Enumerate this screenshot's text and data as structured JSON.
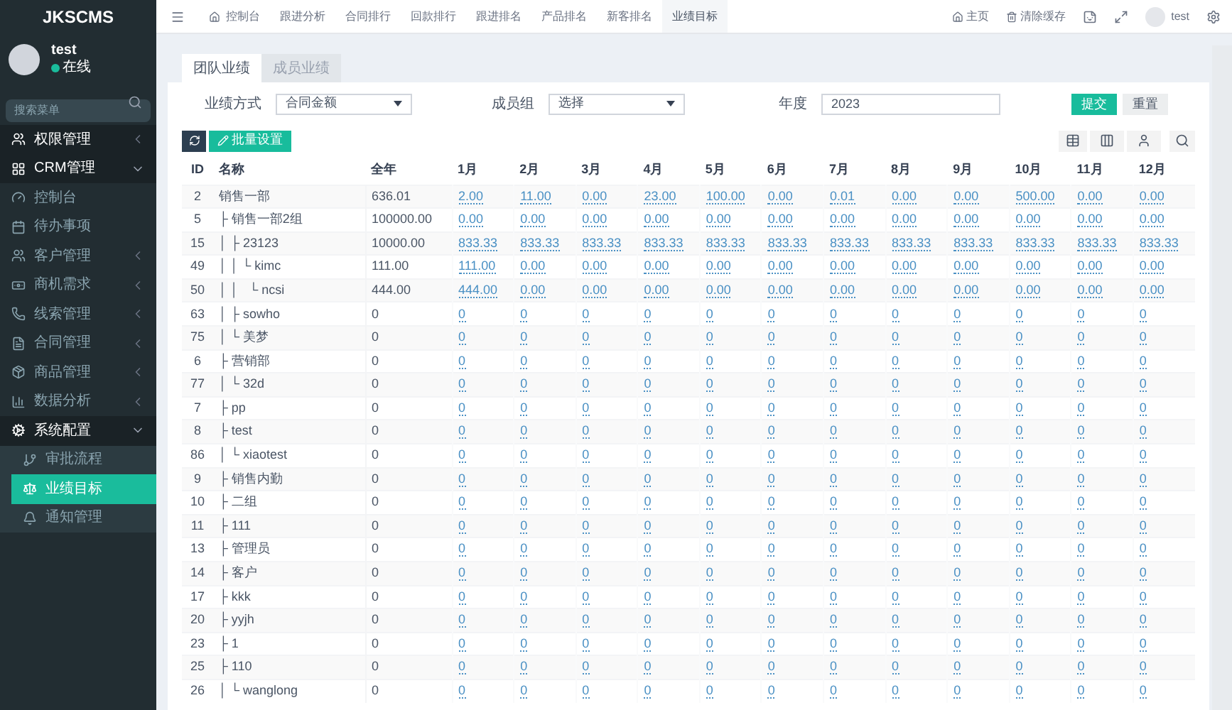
{
  "brand": "JKSCMS",
  "user": {
    "name": "test",
    "status": "在线"
  },
  "sidebar": {
    "search_placeholder": "搜索菜单",
    "items": [
      {
        "label": "权限管理",
        "expanded": false,
        "selected": false
      },
      {
        "label": "CRM管理",
        "expanded": true,
        "selected": false,
        "children": [
          {
            "label": "控制台",
            "selected": false
          },
          {
            "label": "待办事项",
            "selected": false
          },
          {
            "label": "客户管理",
            "selected": false,
            "expanded": false
          },
          {
            "label": "商机需求",
            "selected": false,
            "expanded": false
          },
          {
            "label": "线索管理",
            "selected": false,
            "expanded": false
          },
          {
            "label": "合同管理",
            "selected": false,
            "expanded": false
          },
          {
            "label": "商品管理",
            "selected": false,
            "expanded": false
          },
          {
            "label": "数据分析",
            "selected": false,
            "expanded": false
          },
          {
            "label": "系统配置",
            "selected": false,
            "expanded": true,
            "children": [
              {
                "label": "审批流程",
                "selected": false
              },
              {
                "label": "业绩目标",
                "selected": true
              },
              {
                "label": "通知管理",
                "selected": false
              }
            ]
          }
        ]
      }
    ]
  },
  "nav_tabs": [
    {
      "label": "控制台",
      "selected": false
    },
    {
      "label": "跟进分析",
      "selected": false
    },
    {
      "label": "合同排行",
      "selected": false
    },
    {
      "label": "回款排行",
      "selected": false
    },
    {
      "label": "跟进排名",
      "selected": false
    },
    {
      "label": "产品排名",
      "selected": false
    },
    {
      "label": "新客排名",
      "selected": false
    },
    {
      "label": "业绩目标",
      "selected": true
    }
  ],
  "top_right": {
    "home": "主页",
    "clear_cache": "清除缓存",
    "user": "test"
  },
  "tabs": [
    {
      "label": "团队业绩",
      "selected": true
    },
    {
      "label": "成员业绩",
      "selected": false
    }
  ],
  "filters": {
    "mode_label": "业绩方式",
    "mode_value": "合同金额",
    "group_label": "成员组",
    "group_value": "选择",
    "year_label": "年度",
    "year_value": "2023",
    "submit": "提交",
    "reset": "重置"
  },
  "batch_button": "批量设置",
  "table": {
    "columns": [
      "ID",
      "名称",
      "全年",
      "1月",
      "2月",
      "3月",
      "4月",
      "5月",
      "6月",
      "7月",
      "8月",
      "9月",
      "10月",
      "11月",
      "12月"
    ],
    "rows": [
      {
        "id": "2",
        "name": "销售一部",
        "year": "636.01",
        "months": [
          "2.00",
          "11.00",
          "0.00",
          "23.00",
          "100.00",
          "0.00",
          "0.01",
          "0.00",
          "0.00",
          "500.00",
          "0.00",
          "0.00"
        ]
      },
      {
        "id": "5",
        "name": "├ 销售一部2组",
        "year": "100000.00",
        "months": [
          "0.00",
          "0.00",
          "0.00",
          "0.00",
          "0.00",
          "0.00",
          "0.00",
          "0.00",
          "0.00",
          "0.00",
          "0.00",
          "0.00"
        ]
      },
      {
        "id": "15",
        "name": "│ ├ 23123",
        "year": "10000.00",
        "months": [
          "833.33",
          "833.33",
          "833.33",
          "833.33",
          "833.33",
          "833.33",
          "833.33",
          "833.33",
          "833.33",
          "833.33",
          "833.33",
          "833.33"
        ]
      },
      {
        "id": "49",
        "name": "│ │ └ kimc",
        "year": "111.00",
        "months": [
          "111.00",
          "0.00",
          "0.00",
          "0.00",
          "0.00",
          "0.00",
          "0.00",
          "0.00",
          "0.00",
          "0.00",
          "0.00",
          "0.00"
        ]
      },
      {
        "id": "50",
        "name": "│ │   └ ncsi",
        "year": "444.00",
        "months": [
          "444.00",
          "0.00",
          "0.00",
          "0.00",
          "0.00",
          "0.00",
          "0.00",
          "0.00",
          "0.00",
          "0.00",
          "0.00",
          "0.00"
        ]
      },
      {
        "id": "63",
        "name": "│ ├ sowho",
        "year": "0",
        "months": [
          "0",
          "0",
          "0",
          "0",
          "0",
          "0",
          "0",
          "0",
          "0",
          "0",
          "0",
          "0"
        ]
      },
      {
        "id": "75",
        "name": "│ └ 美梦",
        "year": "0",
        "months": [
          "0",
          "0",
          "0",
          "0",
          "0",
          "0",
          "0",
          "0",
          "0",
          "0",
          "0",
          "0"
        ]
      },
      {
        "id": "6",
        "name": "├ 营销部",
        "year": "0",
        "months": [
          "0",
          "0",
          "0",
          "0",
          "0",
          "0",
          "0",
          "0",
          "0",
          "0",
          "0",
          "0"
        ]
      },
      {
        "id": "77",
        "name": "│ └ 32d",
        "year": "0",
        "months": [
          "0",
          "0",
          "0",
          "0",
          "0",
          "0",
          "0",
          "0",
          "0",
          "0",
          "0",
          "0"
        ]
      },
      {
        "id": "7",
        "name": "├ pp",
        "year": "0",
        "months": [
          "0",
          "0",
          "0",
          "0",
          "0",
          "0",
          "0",
          "0",
          "0",
          "0",
          "0",
          "0"
        ]
      },
      {
        "id": "8",
        "name": "├ test",
        "year": "0",
        "months": [
          "0",
          "0",
          "0",
          "0",
          "0",
          "0",
          "0",
          "0",
          "0",
          "0",
          "0",
          "0"
        ]
      },
      {
        "id": "86",
        "name": "│ └ xiaotest",
        "year": "0",
        "months": [
          "0",
          "0",
          "0",
          "0",
          "0",
          "0",
          "0",
          "0",
          "0",
          "0",
          "0",
          "0"
        ]
      },
      {
        "id": "9",
        "name": "├ 销售内勤",
        "year": "0",
        "months": [
          "0",
          "0",
          "0",
          "0",
          "0",
          "0",
          "0",
          "0",
          "0",
          "0",
          "0",
          "0"
        ]
      },
      {
        "id": "10",
        "name": "├ 二组",
        "year": "0",
        "months": [
          "0",
          "0",
          "0",
          "0",
          "0",
          "0",
          "0",
          "0",
          "0",
          "0",
          "0",
          "0"
        ]
      },
      {
        "id": "11",
        "name": "├ 111",
        "year": "0",
        "months": [
          "0",
          "0",
          "0",
          "0",
          "0",
          "0",
          "0",
          "0",
          "0",
          "0",
          "0",
          "0"
        ]
      },
      {
        "id": "13",
        "name": "├ 管理员",
        "year": "0",
        "months": [
          "0",
          "0",
          "0",
          "0",
          "0",
          "0",
          "0",
          "0",
          "0",
          "0",
          "0",
          "0"
        ]
      },
      {
        "id": "14",
        "name": "├ 客户",
        "year": "0",
        "months": [
          "0",
          "0",
          "0",
          "0",
          "0",
          "0",
          "0",
          "0",
          "0",
          "0",
          "0",
          "0"
        ]
      },
      {
        "id": "17",
        "name": "├ kkk",
        "year": "0",
        "months": [
          "0",
          "0",
          "0",
          "0",
          "0",
          "0",
          "0",
          "0",
          "0",
          "0",
          "0",
          "0"
        ]
      },
      {
        "id": "20",
        "name": "├ yyjh",
        "year": "0",
        "months": [
          "0",
          "0",
          "0",
          "0",
          "0",
          "0",
          "0",
          "0",
          "0",
          "0",
          "0",
          "0"
        ]
      },
      {
        "id": "23",
        "name": "├ 1",
        "year": "0",
        "months": [
          "0",
          "0",
          "0",
          "0",
          "0",
          "0",
          "0",
          "0",
          "0",
          "0",
          "0",
          "0"
        ]
      },
      {
        "id": "25",
        "name": "├ 110",
        "year": "0",
        "months": [
          "0",
          "0",
          "0",
          "0",
          "0",
          "0",
          "0",
          "0",
          "0",
          "0",
          "0",
          "0"
        ]
      },
      {
        "id": "26",
        "name": "│ └ wanglong",
        "year": "0",
        "months": [
          "0",
          "0",
          "0",
          "0",
          "0",
          "0",
          "0",
          "0",
          "0",
          "0",
          "0",
          "0"
        ]
      }
    ]
  }
}
